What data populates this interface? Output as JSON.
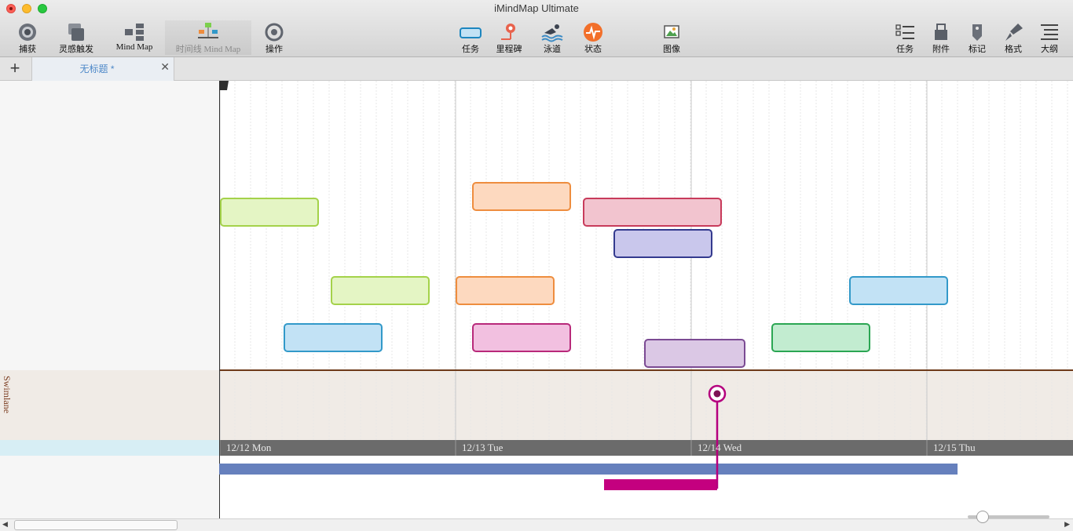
{
  "window": {
    "title": "iMindMap Ultimate"
  },
  "toolbar": {
    "capture": "捕获",
    "brainstorm": "灵感触发",
    "mindmap": "Mind Map",
    "timeline_mindmap": "时间线 Mind Map",
    "actions": "操作",
    "task": "任务",
    "milestone": "里程碑",
    "swimlane": "泳道",
    "status": "状态",
    "image": "图像",
    "task_panel": "任务",
    "attachments": "附件",
    "marker": "标记",
    "format": "格式",
    "outline": "大纲"
  },
  "tabs": [
    {
      "label": "无标题 *"
    }
  ],
  "swimlane": {
    "label": "Swimlane"
  },
  "timeline": {
    "dates": [
      "12/12 Mon",
      "12/13 Tue",
      "12/14 Wed",
      "12/15 Thu"
    ]
  },
  "tasks": [
    {
      "color": "#a4d24a",
      "fill": "#e4f5c4",
      "day_start": 0.0,
      "day_end": 0.42,
      "row": 4
    },
    {
      "color": "#ee8d3e",
      "fill": "#fdd9bf",
      "day_start": 1.07,
      "day_end": 1.49,
      "row": 1
    },
    {
      "color": "#333a8e",
      "fill": "#c9c7ec",
      "day_start": 1.67,
      "day_end": 2.09,
      "row": 2
    },
    {
      "color": "#a4d24a",
      "fill": "#e4f5c4",
      "day_start": 0.47,
      "day_end": 0.89,
      "row": 3
    },
    {
      "color": "#ee8d3e",
      "fill": "#fdd9bf",
      "day_start": 1.0,
      "day_end": 1.42,
      "row": 3
    },
    {
      "color": "#c83b5b",
      "fill": "#f2c4cf",
      "day_start": 1.54,
      "day_end": 2.13,
      "row": 4
    },
    {
      "color": "#3299c9",
      "fill": "#c2e2f5",
      "day_start": 2.67,
      "day_end": 3.09,
      "row": 3
    },
    {
      "color": "#3299c9",
      "fill": "#c2e2f5",
      "day_start": 0.27,
      "day_end": 0.69,
      "row": 5
    },
    {
      "color": "#b8297a",
      "fill": "#f2c0e0",
      "day_start": 1.07,
      "day_end": 1.49,
      "row": 5
    },
    {
      "color": "#7b4a93",
      "fill": "#dbc8e5",
      "day_start": 1.8,
      "day_end": 2.23,
      "row": 6
    },
    {
      "color": "#2ba653",
      "fill": "#c2ecd0",
      "day_start": 2.34,
      "day_end": 2.76,
      "row": 5
    }
  ],
  "milestone": {
    "color": "#b5007e",
    "day": 2.11
  },
  "overview_bars": [
    {
      "color": "#6680bd",
      "day_start": -0.02,
      "day_end": 3.13
    },
    {
      "color": "#c4007f",
      "day_start": 1.63,
      "day_end": 2.11
    }
  ],
  "icons": {
    "capture": "camera-aperture-icon",
    "brainstorm": "stacked-cards-icon",
    "mindmap": "mindmap-branches-icon",
    "timeline": "timeline-map-icon",
    "actions": "refresh-icon",
    "task": "task-bar-icon",
    "milestone": "milestone-pin-icon",
    "swimlane": "swimmer-icon",
    "status": "pulse-icon",
    "image": "picture-icon"
  }
}
